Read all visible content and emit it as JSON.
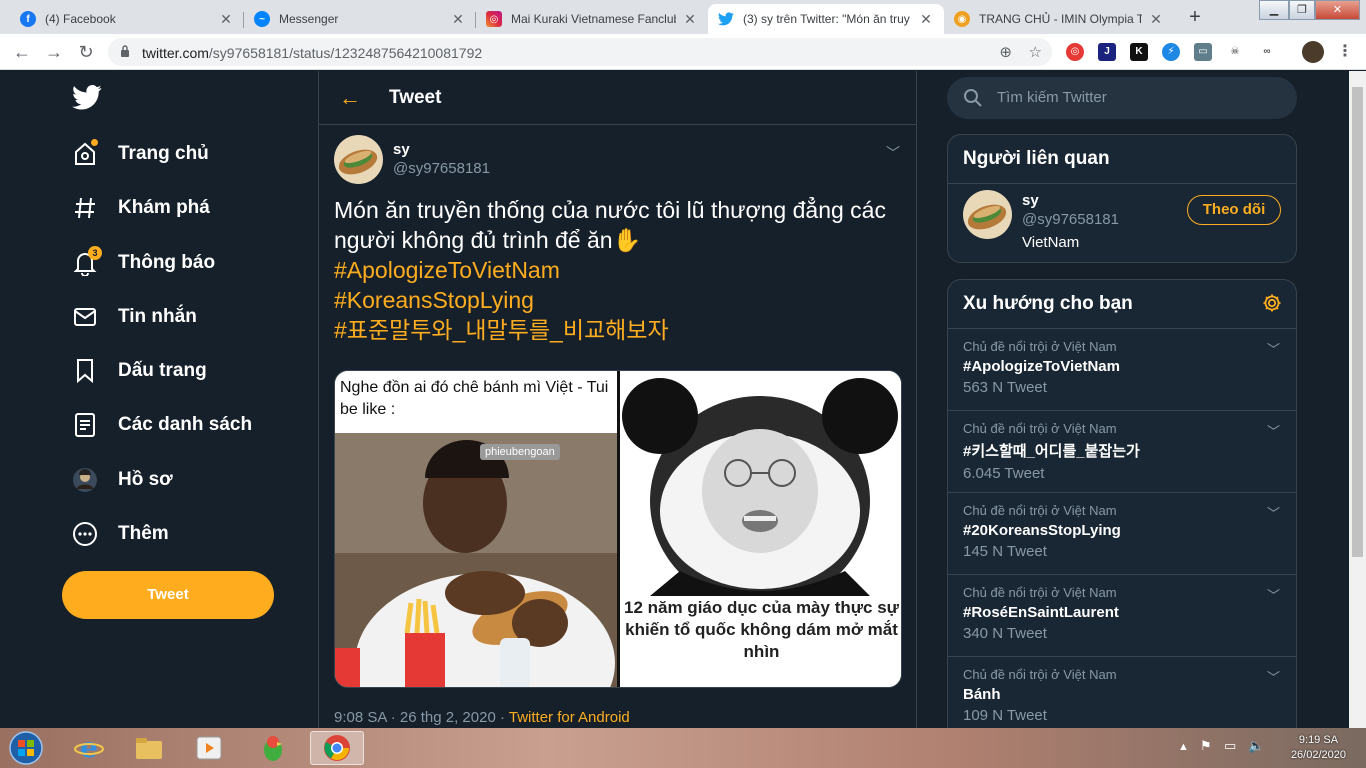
{
  "browser": {
    "tabs": [
      {
        "label": "(4) Facebook",
        "icon": "facebook-icon"
      },
      {
        "label": "Messenger",
        "icon": "messenger-icon"
      },
      {
        "label": "Mai Kuraki Vietnamese Fanclub",
        "icon": "instagram-icon"
      },
      {
        "label": "(3) sy trên Twitter: \"Món ăn truy",
        "icon": "twitter-icon"
      },
      {
        "label": "TRANG CHỦ - IMIN Olympia Tra",
        "icon": "imin-icon"
      }
    ],
    "url_domain": "twitter.com",
    "url_path": "/sy97658181/status/1232487564210081792"
  },
  "nav": {
    "items": [
      {
        "label": "Trang chủ",
        "icon": "home-icon"
      },
      {
        "label": "Khám phá",
        "icon": "hashtag-icon"
      },
      {
        "label": "Thông báo",
        "icon": "bell-icon",
        "badge": "3"
      },
      {
        "label": "Tin nhắn",
        "icon": "mail-icon"
      },
      {
        "label": "Dấu trang",
        "icon": "bookmark-icon"
      },
      {
        "label": "Các danh sách",
        "icon": "list-icon"
      },
      {
        "label": "Hồ sơ",
        "icon": "profile-avatar"
      },
      {
        "label": "Thêm",
        "icon": "more-icon"
      }
    ],
    "tweet_button": "Tweet"
  },
  "header": {
    "title": "Tweet"
  },
  "tweet": {
    "name": "sy",
    "handle": "@sy97658181",
    "text_line1": "Món ăn truyền thống của nước tôi lũ thượng đẳng các",
    "text_line2": "người không đủ trình để ăn✋",
    "hashtags": [
      "#ApologizeToVietNam",
      "#KoreansStopLying",
      "#표준말투와_내말투를_비교해보자"
    ],
    "image_caption_left": "Nghe đồn ai đó chê bánh mì Việt - Tui be like :",
    "image_watermark": "phieubengoan",
    "image_caption_right": "12 năm giáo dục của mày thực sự khiến tổ quốc không dám mở mắt nhìn",
    "timestamp": "9:08 SA · 26 thg 2, 2020 · ",
    "source": "Twitter for Android"
  },
  "search": {
    "placeholder": "Tìm kiếm Twitter"
  },
  "related": {
    "title": "Người liên quan",
    "name": "sy",
    "handle": "@sy97658181",
    "bio": "VietNam",
    "follow_label": "Theo dõi"
  },
  "trends": {
    "title": "Xu hướng cho bạn",
    "items": [
      {
        "context": "Chủ đề nổi trội ở Việt Nam",
        "name": "#ApologizeToVietNam",
        "count": "563 N Tweet"
      },
      {
        "context": "Chủ đề nổi trội ở Việt Nam",
        "name": "#키스할때_어디를_붙잡는가",
        "count": "6.045 Tweet"
      },
      {
        "context": "Chủ đề nổi trội ở Việt Nam",
        "name": "#20KoreansStopLying",
        "count": "145 N Tweet"
      },
      {
        "context": "Chủ đề nổi trội ở Việt Nam",
        "name": "#RoséEnSaintLaurent",
        "count": "340 N Tweet"
      },
      {
        "context": "Chủ đề nổi trội ở Việt Nam",
        "name": "Bánh",
        "count": "109 N Tweet"
      }
    ]
  },
  "taskbar": {
    "time": "9:19 SA",
    "date": "26/02/2020"
  },
  "colors": {
    "accent": "#ffad1f",
    "background": "#15202b",
    "panel": "#192734",
    "border": "#38444d",
    "muted": "#8899a6"
  }
}
